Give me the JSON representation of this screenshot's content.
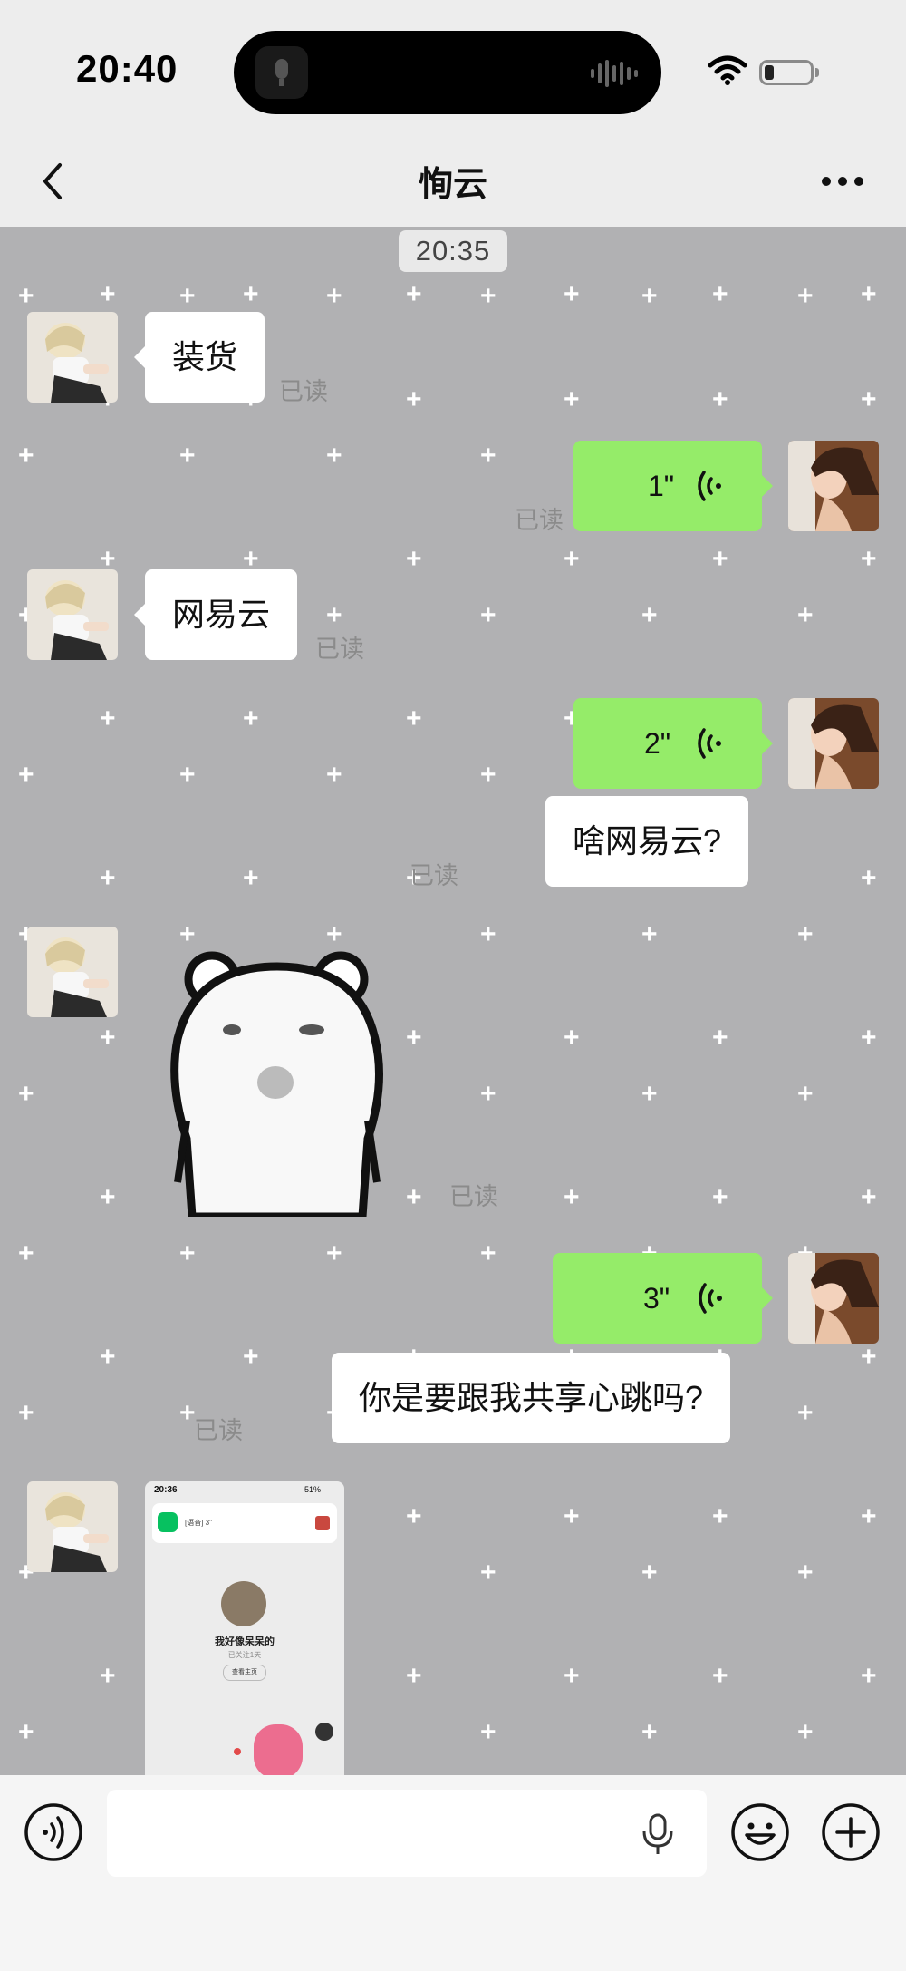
{
  "status_bar": {
    "time": "20:40",
    "icons": [
      "wifi-icon",
      "battery-icon"
    ]
  },
  "nav": {
    "title": "恂云",
    "back_icon": "chevron-left-icon",
    "more_icon": "more-dots-icon"
  },
  "chat": {
    "timestamp": "20:35",
    "read_label": "已读",
    "messages": [
      {
        "side": "in",
        "type": "text",
        "text": "装货"
      },
      {
        "side": "out",
        "type": "voice",
        "duration": "1\""
      },
      {
        "side": "in",
        "type": "text",
        "text": "网易云"
      },
      {
        "side": "out",
        "type": "voice",
        "duration": "2\""
      },
      {
        "side": "out",
        "type": "text",
        "text": "啥网易云?"
      },
      {
        "side": "in",
        "type": "sticker",
        "sticker": "white-bear-sticker"
      },
      {
        "side": "out",
        "type": "voice",
        "duration": "3\""
      },
      {
        "side": "out",
        "type": "text",
        "text": "你是要跟我共享心跳吗?"
      },
      {
        "side": "in",
        "type": "image",
        "image": "screenshot-thumbnail"
      }
    ],
    "thumbnail": {
      "time": "20:36",
      "status_right": "51%",
      "notice_text": "[语音] 3\"",
      "name": "我好像呆呆的",
      "sub": "已关注1天",
      "button": "查看主页"
    }
  },
  "input_bar": {
    "voice_icon": "voice-mode-icon",
    "mic_icon": "microphone-icon",
    "emoji_icon": "emoji-icon",
    "plus_icon": "add-icon"
  },
  "colors": {
    "chat_bg": "#b1b1b3",
    "out_bubble": "#95ec69",
    "in_bubble": "#ffffff"
  }
}
